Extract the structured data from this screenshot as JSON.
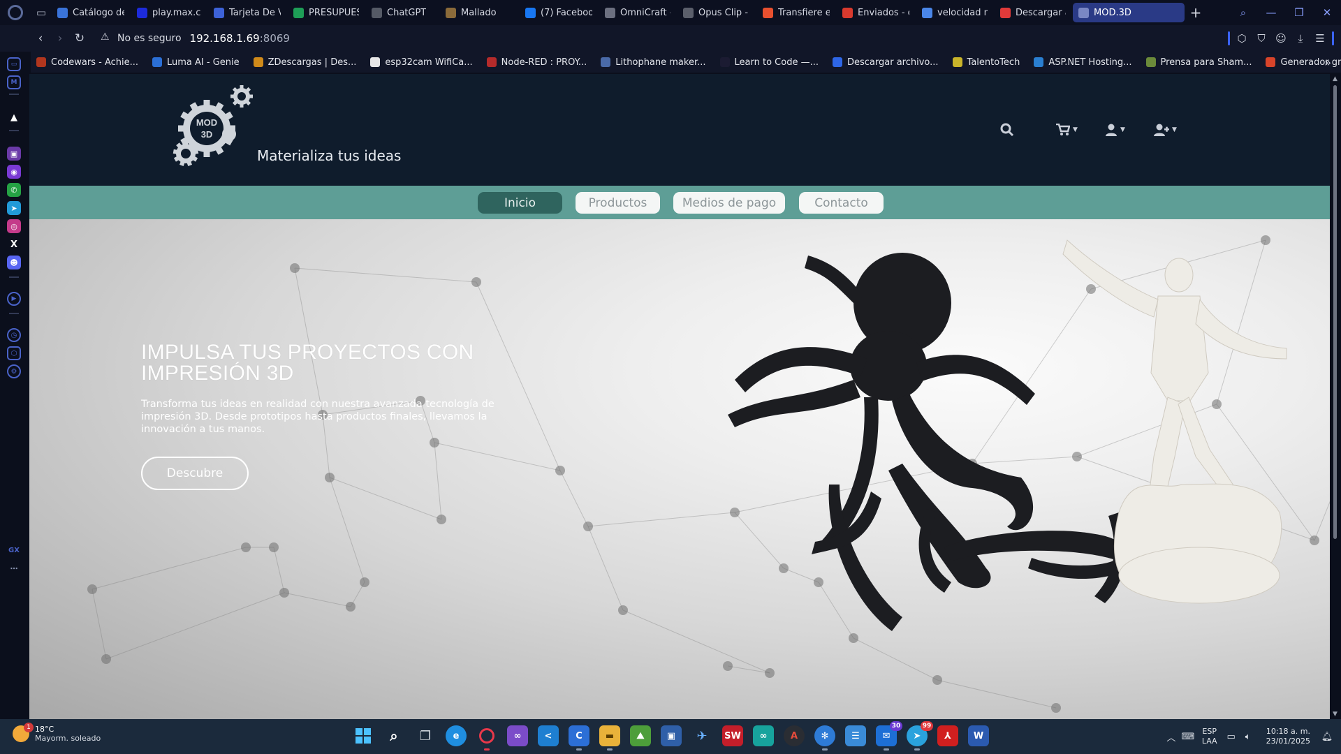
{
  "browser": {
    "tabs": [
      {
        "label": "Catálogo de",
        "icon": "codewars-icon",
        "color": "#3a73d8"
      },
      {
        "label": "play.max.co",
        "icon": "max-icon",
        "color": "#1d2bdb"
      },
      {
        "label": "Tarjeta De V",
        "icon": "tarjeta-icon",
        "color": "#3d62d8"
      },
      {
        "label": "PRESUPUES",
        "icon": "sheets-icon",
        "color": "#1e9e57"
      },
      {
        "label": "ChatGPT",
        "icon": "chatgpt-icon",
        "color": "#555a66"
      },
      {
        "label": "Mallado",
        "icon": "mallado-icon",
        "color": "#8b6b3a"
      },
      {
        "label": "(7) Faceboo",
        "icon": "facebook-icon",
        "color": "#1877f2"
      },
      {
        "label": "OmniCraft -",
        "icon": "omnicraft-icon",
        "color": "#6c7080"
      },
      {
        "label": "Opus Clip -",
        "icon": "opusclip-icon",
        "color": "#5b5f6b"
      },
      {
        "label": "Transfiere e",
        "icon": "microsoft-icon",
        "color": "#e8502f"
      },
      {
        "label": "Enviados - c",
        "icon": "gmail-icon",
        "color": "#d93a2e"
      },
      {
        "label": "velocidad m",
        "icon": "google-icon",
        "color": "#4a86e8"
      },
      {
        "label": "Descargar a",
        "icon": "heart-icon",
        "color": "#e03a3a"
      },
      {
        "label": "MOD.3D",
        "icon": "mod3d-icon",
        "color": "#7a87c4",
        "active": true
      }
    ],
    "address": {
      "security_text": "No es seguro",
      "host": "192.168.1.69",
      "port": ":8069"
    },
    "bookmarks": [
      {
        "label": "Codewars - Achie...",
        "icon": "codewars-icon",
        "color": "#b1361e"
      },
      {
        "label": "Luma AI - Genie",
        "icon": "luma-icon",
        "color": "#2b6fd6"
      },
      {
        "label": "ZDescargas | Des...",
        "icon": "zdescargas-icon",
        "color": "#d08a1a"
      },
      {
        "label": "esp32cam WifiCa...",
        "icon": "document-icon",
        "color": "#e6e6e6"
      },
      {
        "label": "Node-RED : PROY...",
        "icon": "nodered-icon",
        "color": "#b52b2b"
      },
      {
        "label": "Lithophane maker...",
        "icon": "lithophane-icon",
        "color": "#4a6aa8"
      },
      {
        "label": "Learn to Code —...",
        "icon": "freecodecamp-icon",
        "color": "#1b1b32"
      },
      {
        "label": "Descargar archivo...",
        "icon": "dropbox-icon",
        "color": "#2e66e6"
      },
      {
        "label": "TalentoTech",
        "icon": "shield-icon",
        "color": "#c9b42a"
      },
      {
        "label": "ASP.NET Hosting...",
        "icon": "aspnet-icon",
        "color": "#2a7fd1"
      },
      {
        "label": "Prensa para Sham...",
        "icon": "image-icon",
        "color": "#6b8a3a"
      },
      {
        "label": "Generador gratuit...",
        "icon": "generator-icon",
        "color": "#d8442a"
      }
    ]
  },
  "site": {
    "tagline": "Materializa tus ideas",
    "logo_text": "MOD 3D",
    "nav": [
      {
        "label": "Inicio",
        "active": true
      },
      {
        "label": "Productos",
        "active": false
      },
      {
        "label": "Medios de pago",
        "active": false
      },
      {
        "label": "Contacto",
        "active": false
      }
    ],
    "hero": {
      "title_line1": "IMPULSA TUS PROYECTOS CON",
      "title_line2": "IMPRESIÓN 3D",
      "text": "Transforma tus ideas en realidad con nuestra avanzada tecnología de impresión 3D. Desde prototipos hasta productos finales, llevamos la innovación a tus manos.",
      "button": "Descubre"
    },
    "colors": {
      "header_bg": "#0f1c2c",
      "nav_bg": "#5e9e96",
      "nav_active": "#2f645e"
    }
  },
  "taskbar": {
    "weather_temp": "18°C",
    "weather_cond": "Mayorm. soleado",
    "weather_badge": "1",
    "lang_line1": "ESP",
    "lang_line2": "LAA",
    "time": "10:18 a. m.",
    "date": "23/01/2025",
    "badge_mail": "30",
    "badge_telegram": "99"
  }
}
